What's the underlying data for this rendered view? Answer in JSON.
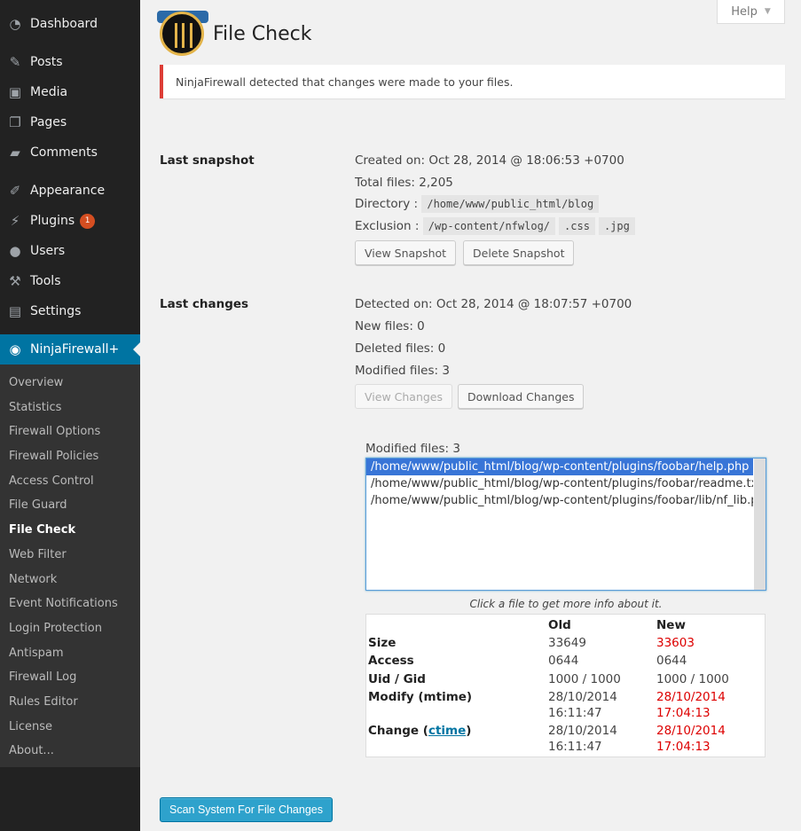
{
  "sidebar": {
    "items": [
      {
        "label": "Dashboard",
        "icon": "dashboard-icon"
      },
      {
        "label": "Posts",
        "icon": "pin-icon"
      },
      {
        "label": "Media",
        "icon": "media-icon"
      },
      {
        "label": "Pages",
        "icon": "pages-icon"
      },
      {
        "label": "Comments",
        "icon": "comment-icon"
      },
      {
        "label": "Appearance",
        "icon": "brush-icon"
      },
      {
        "label": "Plugins",
        "icon": "plugin-icon",
        "badge": "1"
      },
      {
        "label": "Users",
        "icon": "user-icon"
      },
      {
        "label": "Tools",
        "icon": "wrench-icon"
      },
      {
        "label": "Settings",
        "icon": "settings-icon"
      },
      {
        "label": "NinjaFirewall+",
        "icon": "ninja-icon"
      }
    ],
    "submenu": [
      "Overview",
      "Statistics",
      "Firewall Options",
      "Firewall Policies",
      "Access Control",
      "File Guard",
      "File Check",
      "Web Filter",
      "Network",
      "Event Notifications",
      "Login Protection",
      "Antispam",
      "Firewall Log",
      "Rules Editor",
      "License",
      "About..."
    ]
  },
  "header": {
    "help_label": "Help",
    "title": "File Check"
  },
  "notice": "NinjaFirewall detected that changes were made to your files.",
  "snapshot": {
    "label": "Last snapshot",
    "created": "Created on: Oct 28, 2014 @ 18:06:53 +0700",
    "total": "Total files: 2,205",
    "dir_label": "Directory :",
    "dir": "/home/www/public_html/blog",
    "excl_label": "Exclusion :",
    "exclusions": [
      "/wp-content/nfwlog/",
      ".css",
      ".jpg"
    ],
    "view_btn": "View Snapshot",
    "delete_btn": "Delete Snapshot"
  },
  "changes": {
    "label": "Last changes",
    "detected": "Detected on: Oct 28, 2014 @ 18:07:57 +0700",
    "new_files": "New files: 0",
    "deleted_files": "Deleted files: 0",
    "modified_files": "Modified files: 3",
    "view_btn": "View Changes",
    "download_btn": "Download Changes"
  },
  "modified": {
    "label": "Modified files: 3",
    "files": [
      "/home/www/public_html/blog/wp-content/plugins/foobar/help.php",
      "/home/www/public_html/blog/wp-content/plugins/foobar/readme.txt",
      "/home/www/public_html/blog/wp-content/plugins/foobar/lib/nf_lib.php"
    ],
    "hint": "Click a file to get more info about it."
  },
  "info": {
    "col_old": "Old",
    "col_new": "New",
    "size_label": "Size",
    "size_old": "33649",
    "size_new": "33603",
    "access_label": "Access",
    "access_old": "0644",
    "access_new": "0644",
    "uid_label": "Uid / Gid",
    "uid_old": "1000 / 1000",
    "uid_new": "1000 / 1000",
    "mtime_label": "Modify (mtime)",
    "mtime_old_d": "28/10/2014",
    "mtime_old_t": "16:11:47",
    "mtime_new_d": "28/10/2014",
    "mtime_new_t": "17:04:13",
    "ctime_label_a": "Change (",
    "ctime_link": "ctime",
    "ctime_label_b": ")",
    "ctime_old_d": "28/10/2014",
    "ctime_old_t": "16:11:47",
    "ctime_new_d": "28/10/2014",
    "ctime_new_t": "17:04:13"
  },
  "scan_btn": "Scan System For File Changes",
  "colors": {
    "accent": "#0074a2",
    "alert": "#dd3d36",
    "changed": "#dd0000"
  }
}
